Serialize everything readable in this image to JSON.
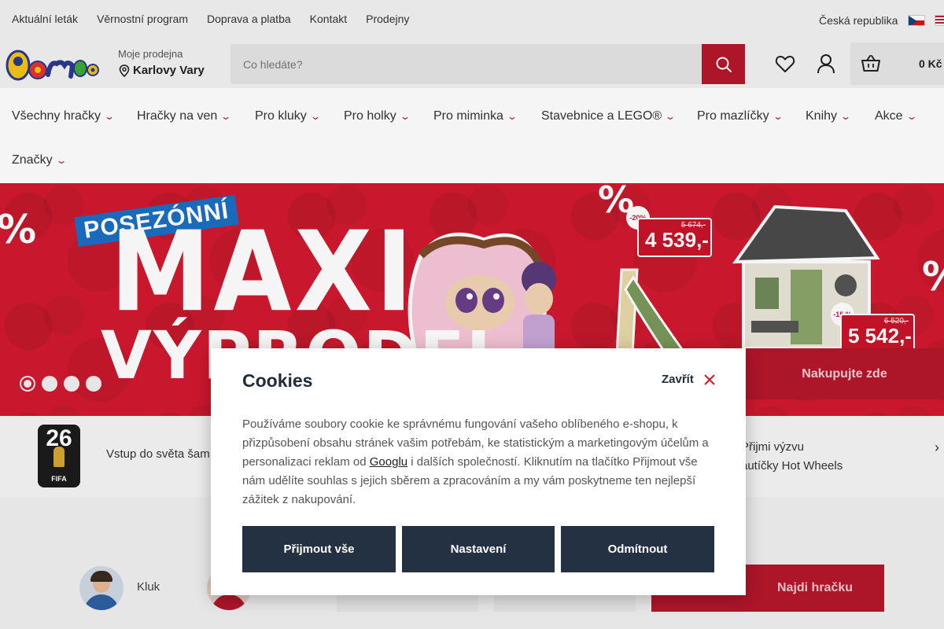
{
  "topbar": {
    "links": [
      "Aktuální leták",
      "Věrnostní program",
      "Doprava a platba",
      "Kontakt",
      "Prodejny"
    ],
    "country": "Česká republika"
  },
  "header": {
    "store_label": "Moje prodejna",
    "store_name": "Karlovy Vary",
    "search_placeholder": "Co hledáte?",
    "cart_price": "0 Kč",
    "brand_color": "#b5162b"
  },
  "nav": {
    "items": [
      "Všechny hračky",
      "Hračky na ven",
      "Pro kluky",
      "Pro holky",
      "Pro miminka",
      "Stavebnice a LEGO®",
      "Pro mazlíčky",
      "Knihy",
      "Akce",
      "Značky"
    ]
  },
  "banner": {
    "tagline": "POSEZÓNNÍ",
    "headline": "MAXI",
    "headline2": "VÝPRODEJ",
    "offer1": {
      "discount": "-20%",
      "old_price": "5 674,-",
      "new_price": "4 539,-"
    },
    "offer2": {
      "discount": "-15 %",
      "old_price": "6 520,-",
      "new_price": "5 542,-"
    },
    "cta": "Nakupujte zde",
    "slides": 4,
    "active_slide": 1
  },
  "promos": {
    "fifa_number": "26",
    "fifa_label": "FIFA",
    "item1": "Vstup do světa šam",
    "item2_line1": "Přijmi výzvu",
    "item2_line2": "autíčky Hot Wheels"
  },
  "finder": {
    "avatar_label": "Kluk",
    "button": "Najdi hračku"
  },
  "cookies": {
    "title": "Cookies",
    "close_label": "Zavřít",
    "text_before": "Používáme soubory cookie ke správnému fungování vašeho oblíbeného e-shopu, k přizpůsobení obsahu stránek vašim potřebám, ke statistickým a marketingovým účelům a personalizaci reklam od ",
    "link": "Googlu",
    "text_after": " i dalších společností. Kliknutím na tlačítko Přijmout vše nám udělíte souhlas s jejich sběrem a zpracováním a my vám poskytneme ten nejlepší zážitek z nakupování.",
    "accept": "Přijmout vše",
    "settings": "Nastavení",
    "reject": "Odmítnout"
  }
}
